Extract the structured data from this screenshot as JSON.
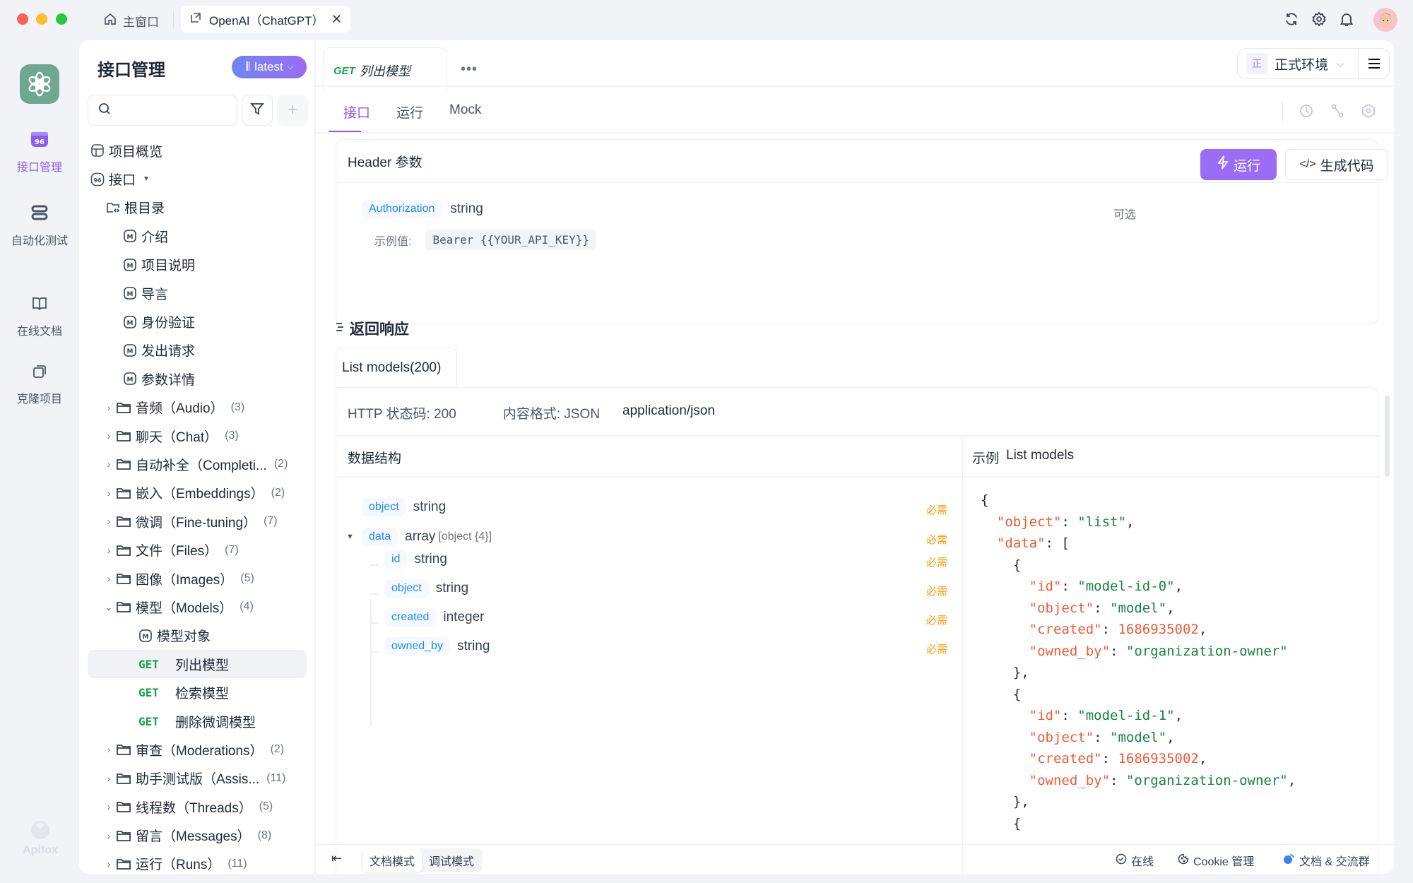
{
  "titlebar": {
    "home_tab": "主窗口",
    "active_tab": "OpenAI（ChatGPT）",
    "close": "✕",
    "icons": [
      "refresh-icon",
      "settings-icon",
      "bell-icon",
      "avatar"
    ]
  },
  "rail": {
    "items": [
      {
        "label": "接口管理",
        "icon": "api-icon",
        "active": true
      },
      {
        "label": "自动化测试",
        "icon": "automation-icon",
        "active": false
      },
      {
        "label": "在线文档",
        "icon": "book-icon",
        "active": false
      },
      {
        "label": "克隆项目",
        "icon": "clone-icon",
        "active": false
      }
    ],
    "brand": "Apifox"
  },
  "sidebar": {
    "title": "接口管理",
    "version": "latest",
    "search_placeholder": "",
    "add": "+",
    "overview": "项目概览",
    "api_root": "接口",
    "root_dir": "根目录",
    "docs": [
      "介绍",
      "项目说明",
      "导言",
      "身份验证",
      "发出请求",
      "参数详情"
    ],
    "folders_a": [
      {
        "name": "音频（Audio）",
        "count": "(3)"
      },
      {
        "name": "聊天（Chat）",
        "count": "(3)"
      },
      {
        "name": "自动补全（Completi...",
        "count": "(2)"
      },
      {
        "name": "嵌入（Embeddings）",
        "count": "(2)"
      },
      {
        "name": "微调（Fine-tuning）",
        "count": "(7)"
      },
      {
        "name": "文件（Files）",
        "count": "(7)"
      },
      {
        "name": "图像（Images）",
        "count": "(5)"
      }
    ],
    "models_folder": {
      "name": "模型（Models）",
      "count": "(4)"
    },
    "models_doc": "模型对象",
    "models_apis": [
      {
        "method": "GET",
        "name": "列出模型",
        "selected": true
      },
      {
        "method": "GET",
        "name": "检索模型",
        "selected": false
      },
      {
        "method": "GET",
        "name": "删除微调模型",
        "selected": false
      }
    ],
    "folders_b": [
      {
        "name": "审查（Moderations）",
        "count": "(2)"
      },
      {
        "name": "助手测试版（Assis...",
        "count": "(11)"
      },
      {
        "name": "线程数（Threads）",
        "count": "(5)"
      },
      {
        "name": "留言（Messages）",
        "count": "(8)"
      },
      {
        "name": "运行（Runs）",
        "count": "(11)"
      }
    ]
  },
  "main": {
    "doc_tab": {
      "method": "GET",
      "name": "列出模型"
    },
    "more": "•••",
    "env": {
      "badge": "正",
      "name": "正式环境"
    },
    "subtabs": [
      "接口",
      "运行",
      "Mock"
    ],
    "active_subtab": 0,
    "run_button": "运行",
    "gen_code_button": "生成代码",
    "header_params": {
      "title": "Header 参数",
      "param_name": "Authorization",
      "param_type": "string",
      "optional": "可选",
      "example_label": "示例值:",
      "example_value": "Bearer {{YOUR_API_KEY}}"
    },
    "response": {
      "title": "返回响应",
      "tab": "List models(200)",
      "status_label": "HTTP 状态码: 200",
      "format_label": "内容格式: JSON",
      "content_type": "application/json",
      "schema_title": "数据结构",
      "example_title": "示例",
      "example_name": "List models",
      "required_label": "必需",
      "fields": [
        {
          "name": "object",
          "type": "string",
          "extra": "",
          "level": 0
        },
        {
          "name": "data",
          "type": "array",
          "extra": "[object {4}]",
          "level": 0
        },
        {
          "name": "id",
          "type": "string",
          "extra": "",
          "level": 1
        },
        {
          "name": "object",
          "type": "string",
          "extra": "",
          "level": 1
        },
        {
          "name": "created",
          "type": "integer",
          "extra": "",
          "level": 1
        },
        {
          "name": "owned_by",
          "type": "string",
          "extra": "",
          "level": 1
        }
      ],
      "example_lines": [
        [
          [
            "p",
            "{"
          ]
        ],
        [
          [
            "p",
            "  "
          ],
          [
            "k",
            "\"object\""
          ],
          [
            "p",
            ": "
          ],
          [
            "s",
            "\"list\""
          ],
          [
            "p",
            ","
          ]
        ],
        [
          [
            "p",
            "  "
          ],
          [
            "k",
            "\"data\""
          ],
          [
            "p",
            ": ["
          ]
        ],
        [
          [
            "p",
            "    {"
          ]
        ],
        [
          [
            "p",
            "      "
          ],
          [
            "k",
            "\"id\""
          ],
          [
            "p",
            ": "
          ],
          [
            "s",
            "\"model-id-0\""
          ],
          [
            "p",
            ","
          ]
        ],
        [
          [
            "p",
            "      "
          ],
          [
            "k",
            "\"object\""
          ],
          [
            "p",
            ": "
          ],
          [
            "s",
            "\"model\""
          ],
          [
            "p",
            ","
          ]
        ],
        [
          [
            "p",
            "      "
          ],
          [
            "k",
            "\"created\""
          ],
          [
            "p",
            ": "
          ],
          [
            "n",
            "1686935002"
          ],
          [
            "p",
            ","
          ]
        ],
        [
          [
            "p",
            "      "
          ],
          [
            "k",
            "\"owned_by\""
          ],
          [
            "p",
            ": "
          ],
          [
            "s",
            "\"organization-owner\""
          ]
        ],
        [
          [
            "p",
            "    },"
          ]
        ],
        [
          [
            "p",
            "    {"
          ]
        ],
        [
          [
            "p",
            "      "
          ],
          [
            "k",
            "\"id\""
          ],
          [
            "p",
            ": "
          ],
          [
            "s",
            "\"model-id-1\""
          ],
          [
            "p",
            ","
          ]
        ],
        [
          [
            "p",
            "      "
          ],
          [
            "k",
            "\"object\""
          ],
          [
            "p",
            ": "
          ],
          [
            "s",
            "\"model\""
          ],
          [
            "p",
            ","
          ]
        ],
        [
          [
            "p",
            "      "
          ],
          [
            "k",
            "\"created\""
          ],
          [
            "p",
            ": "
          ],
          [
            "n",
            "1686935002"
          ],
          [
            "p",
            ","
          ]
        ],
        [
          [
            "p",
            "      "
          ],
          [
            "k",
            "\"owned_by\""
          ],
          [
            "p",
            ": "
          ],
          [
            "s",
            "\"organization-owner\""
          ],
          [
            "p",
            ","
          ]
        ],
        [
          [
            "p",
            "    },"
          ]
        ],
        [
          [
            "p",
            "    {"
          ]
        ]
      ]
    },
    "footer": {
      "mode_doc": "文档模式",
      "mode_debug": "调试模式",
      "online": "在线",
      "cookie": "Cookie 管理",
      "community": "文档 & 交流群"
    }
  },
  "colors": {
    "accent": "#8b5cf6",
    "get": "#16a34a",
    "required": "#f59e0b",
    "field": "#1d8bf1"
  }
}
